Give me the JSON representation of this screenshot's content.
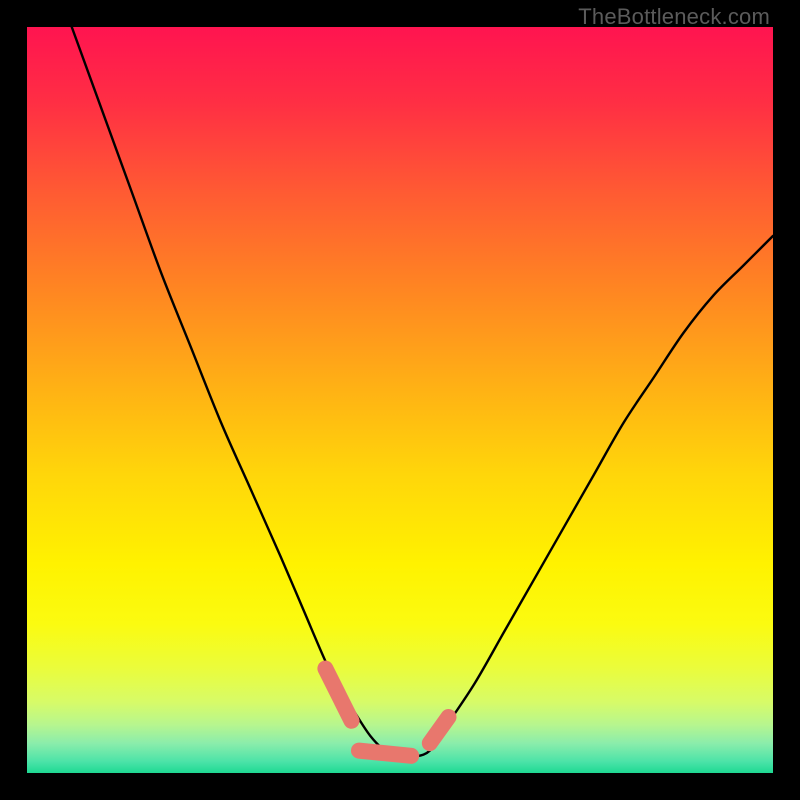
{
  "watermark": "TheBottleneck.com",
  "chart_data": {
    "type": "line",
    "title": "",
    "xlabel": "",
    "ylabel": "",
    "xlim": [
      0,
      100
    ],
    "ylim": [
      0,
      100
    ],
    "grid": false,
    "legend": false,
    "series": [
      {
        "name": "bottleneck-curve",
        "x": [
          6,
          10,
          14,
          18,
          22,
          26,
          30,
          34,
          37,
          40,
          42,
          44,
          46,
          48,
          50,
          52,
          54,
          56,
          60,
          64,
          68,
          72,
          76,
          80,
          84,
          88,
          92,
          96,
          100
        ],
        "y": [
          100,
          89,
          78,
          67,
          57,
          47,
          38,
          29,
          22,
          15,
          11,
          8,
          5,
          3,
          2.2,
          2.2,
          3,
          6,
          12,
          19,
          26,
          33,
          40,
          47,
          53,
          59,
          64,
          68,
          72
        ]
      }
    ],
    "markers": [
      {
        "name": "left-descending-marker",
        "x1": 40.0,
        "y1": 14.0,
        "x2": 43.5,
        "y2": 7.0
      },
      {
        "name": "bottom-flat-marker",
        "x1": 44.5,
        "y1": 3.0,
        "x2": 51.5,
        "y2": 2.3
      },
      {
        "name": "right-ascending-marker",
        "x1": 54.0,
        "y1": 4.0,
        "x2": 56.5,
        "y2": 7.5
      }
    ],
    "background_gradient": {
      "stops": [
        {
          "offset": 0.0,
          "color": "#ff1450"
        },
        {
          "offset": 0.1,
          "color": "#ff2e44"
        },
        {
          "offset": 0.22,
          "color": "#ff5a33"
        },
        {
          "offset": 0.35,
          "color": "#ff8522"
        },
        {
          "offset": 0.48,
          "color": "#ffb015"
        },
        {
          "offset": 0.6,
          "color": "#ffd60a"
        },
        {
          "offset": 0.72,
          "color": "#fff200"
        },
        {
          "offset": 0.8,
          "color": "#fbfb10"
        },
        {
          "offset": 0.86,
          "color": "#eafc3c"
        },
        {
          "offset": 0.905,
          "color": "#d7fb68"
        },
        {
          "offset": 0.935,
          "color": "#b7f68e"
        },
        {
          "offset": 0.96,
          "color": "#8bedab"
        },
        {
          "offset": 0.985,
          "color": "#4be3a8"
        },
        {
          "offset": 1.0,
          "color": "#1ed992"
        }
      ]
    },
    "colors": {
      "curve_stroke": "#000000",
      "marker_fill": "#e8776d",
      "frame_background": "#000000"
    }
  }
}
